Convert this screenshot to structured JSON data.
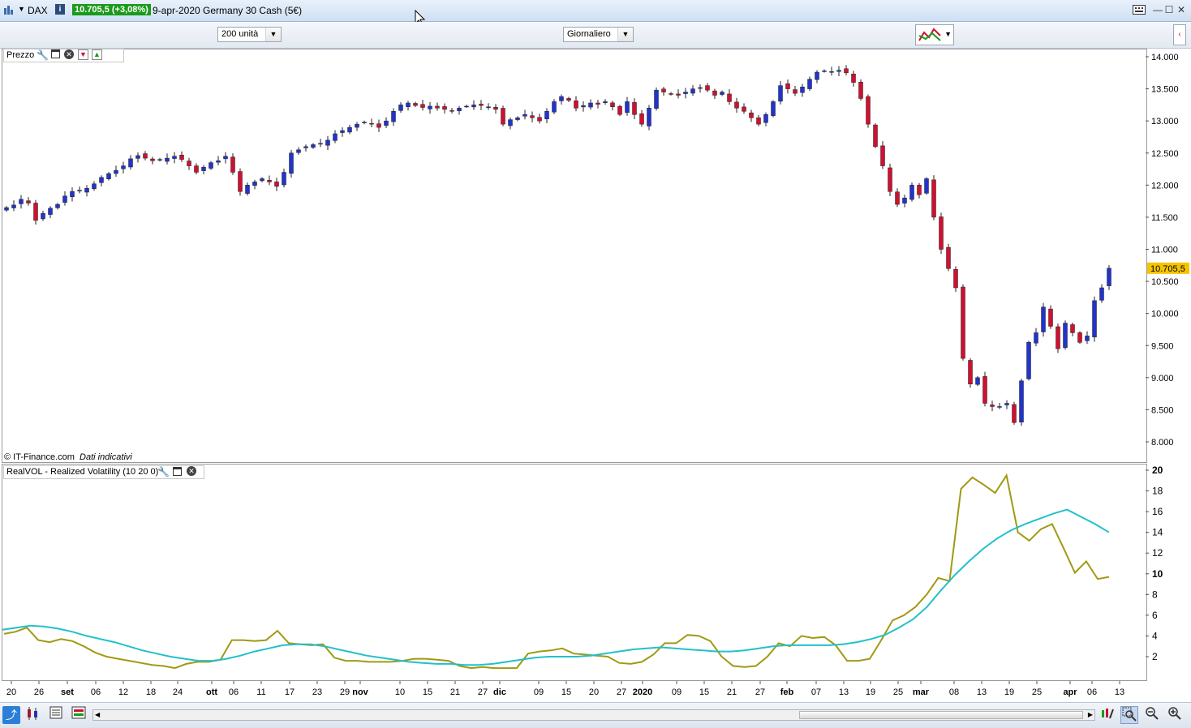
{
  "titlebar": {
    "symbol": "DAX",
    "info_icon": "info-icon",
    "price_badge": "10.705,5 (+3,08%)",
    "description": "9-apr-2020 Germany 30 Cash (5€)",
    "badge_color": "#1a9a1a"
  },
  "toolbar": {
    "units_value": "200 unità",
    "period_value": "Giornaliero"
  },
  "price_panel": {
    "label": "Prezzo",
    "copyright": "© IT-Finance.com",
    "disclaimer": "Dati indicativi",
    "current_price_label": "10.705,5",
    "current_price_color": "#f5c400"
  },
  "vol_panel": {
    "label": "RealVOL - Realized Volatility (10 20 0)"
  },
  "chart_data": [
    {
      "type": "candlestick",
      "title": "",
      "y_ticks": [
        "14.000",
        "13.500",
        "13.000",
        "12.500",
        "12.000",
        "11.500",
        "11.000",
        "10.500",
        "10.000",
        "9.500",
        "9.000",
        "8.500",
        "8.000"
      ],
      "ylim": [
        7950,
        14100
      ],
      "x_ticks": [
        "20",
        "26",
        "set",
        "06",
        "12",
        "18",
        "24",
        "ott",
        "06",
        "11",
        "17",
        "23",
        "29",
        "nov",
        "10",
        "15",
        "21",
        "27",
        "dic",
        "09",
        "15",
        "20",
        "27",
        "2020",
        "09",
        "15",
        "21",
        "27",
        "feb",
        "07",
        "13",
        "19",
        "25",
        "mar",
        "08",
        "13",
        "19",
        "25",
        "apr",
        "06",
        "13"
      ],
      "up_color": "#2233cc",
      "down_color": "#d01030",
      "closes": [
        11650,
        11690,
        11780,
        11720,
        11450,
        11560,
        11640,
        11700,
        11830,
        11900,
        11920,
        11950,
        12020,
        12120,
        12180,
        12230,
        12300,
        12410,
        12460,
        12420,
        12380,
        12400,
        12420,
        12450,
        12400,
        12300,
        12200,
        12280,
        12350,
        12380,
        12450,
        12200,
        11900,
        12000,
        12050,
        12100,
        12050,
        11980,
        12200,
        12500,
        12550,
        12600,
        12630,
        12650,
        12700,
        12800,
        12850,
        12900,
        12950,
        12980,
        12950,
        12900,
        13000,
        13150,
        13250,
        13280,
        13240,
        13210,
        13230,
        13200,
        13180,
        13150,
        13200,
        13230,
        13250,
        13240,
        13220,
        13180,
        12950,
        13020,
        13050,
        13100,
        13050,
        13000,
        13150,
        13300,
        13380,
        13320,
        13200,
        13240,
        13280,
        13260,
        13300,
        13220,
        13100,
        13300,
        13100,
        12950,
        13200,
        13480,
        13450,
        13420,
        13400,
        13450,
        13500,
        13520,
        13480,
        13400,
        13450,
        13300,
        13200,
        13150,
        13050,
        12950,
        13100,
        13300,
        13550,
        13500,
        13430,
        13530,
        13650,
        13760,
        13780,
        13770,
        13790,
        13750,
        13600,
        13350,
        12950,
        12600,
        12300,
        11900,
        11700,
        11800,
        12000,
        11850,
        12100,
        11500,
        11000,
        10700,
        10400,
        9300,
        8900,
        9000,
        8600,
        8550,
        8550,
        8600,
        8300,
        8950,
        9550,
        9700,
        10100,
        9800,
        9450,
        9850,
        9700,
        9550,
        9650,
        10200,
        10400,
        10705
      ],
      "last_price": 10705.5
    },
    {
      "type": "line",
      "title": "",
      "y_ticks": [
        "20",
        "18",
        "16",
        "14",
        "12",
        "10",
        "8",
        "6",
        "4",
        "2"
      ],
      "ylim": [
        0,
        20
      ],
      "series": [
        {
          "color": "#a09a12",
          "values": [
            4.2,
            4.4,
            4.8,
            3.6,
            3.4,
            3.7,
            3.5,
            3.0,
            2.4,
            2.0,
            1.8,
            1.6,
            1.4,
            1.2,
            1.1,
            0.9,
            1.3,
            1.5,
            1.5,
            1.7,
            3.6,
            3.6,
            3.5,
            3.6,
            4.5,
            3.3,
            3.2,
            3.1,
            3.2,
            1.9,
            1.6,
            1.6,
            1.5,
            1.5,
            1.5,
            1.6,
            1.8,
            1.8,
            1.7,
            1.6,
            1.1,
            0.9,
            1.0,
            0.9,
            0.9,
            0.9,
            2.3,
            2.5,
            2.6,
            2.8,
            2.3,
            2.2,
            2.1,
            2.0,
            1.4,
            1.3,
            1.5,
            2.2,
            3.3,
            3.3,
            4.1,
            4.0,
            3.5,
            2.0,
            1.1,
            1.0,
            1.1,
            2.0,
            3.3,
            3.0,
            4.0,
            3.8,
            3.9,
            3.1,
            1.6,
            1.6,
            1.8,
            3.6,
            5.5,
            6.0,
            6.8,
            8.0,
            9.6,
            9.3,
            18.2,
            19.3,
            18.6,
            17.8,
            19.5,
            14.0,
            13.2,
            14.3,
            14.8,
            12.5,
            10.1,
            11.2,
            9.5,
            9.7
          ]
        },
        {
          "color": "#22c0cc",
          "values": [
            4.6,
            4.8,
            5.0,
            4.9,
            4.7,
            4.4,
            4.0,
            3.7,
            3.4,
            3.0,
            2.6,
            2.3,
            2.0,
            1.8,
            1.6,
            1.6,
            1.8,
            2.1,
            2.5,
            2.8,
            3.1,
            3.2,
            3.2,
            3.0,
            2.7,
            2.4,
            2.1,
            1.9,
            1.7,
            1.5,
            1.4,
            1.3,
            1.3,
            1.2,
            1.2,
            1.3,
            1.5,
            1.7,
            1.9,
            2.0,
            2.0,
            2.0,
            2.1,
            2.3,
            2.5,
            2.7,
            2.8,
            2.9,
            2.8,
            2.7,
            2.6,
            2.5,
            2.5,
            2.6,
            2.8,
            3.0,
            3.1,
            3.1,
            3.1,
            3.1,
            3.2,
            3.4,
            3.7,
            4.1,
            4.8,
            5.6,
            6.8,
            8.4,
            9.9,
            11.2,
            12.4,
            13.4,
            14.2,
            14.8,
            15.3,
            15.8,
            16.2,
            15.5,
            14.8,
            14.0
          ]
        }
      ]
    }
  ]
}
